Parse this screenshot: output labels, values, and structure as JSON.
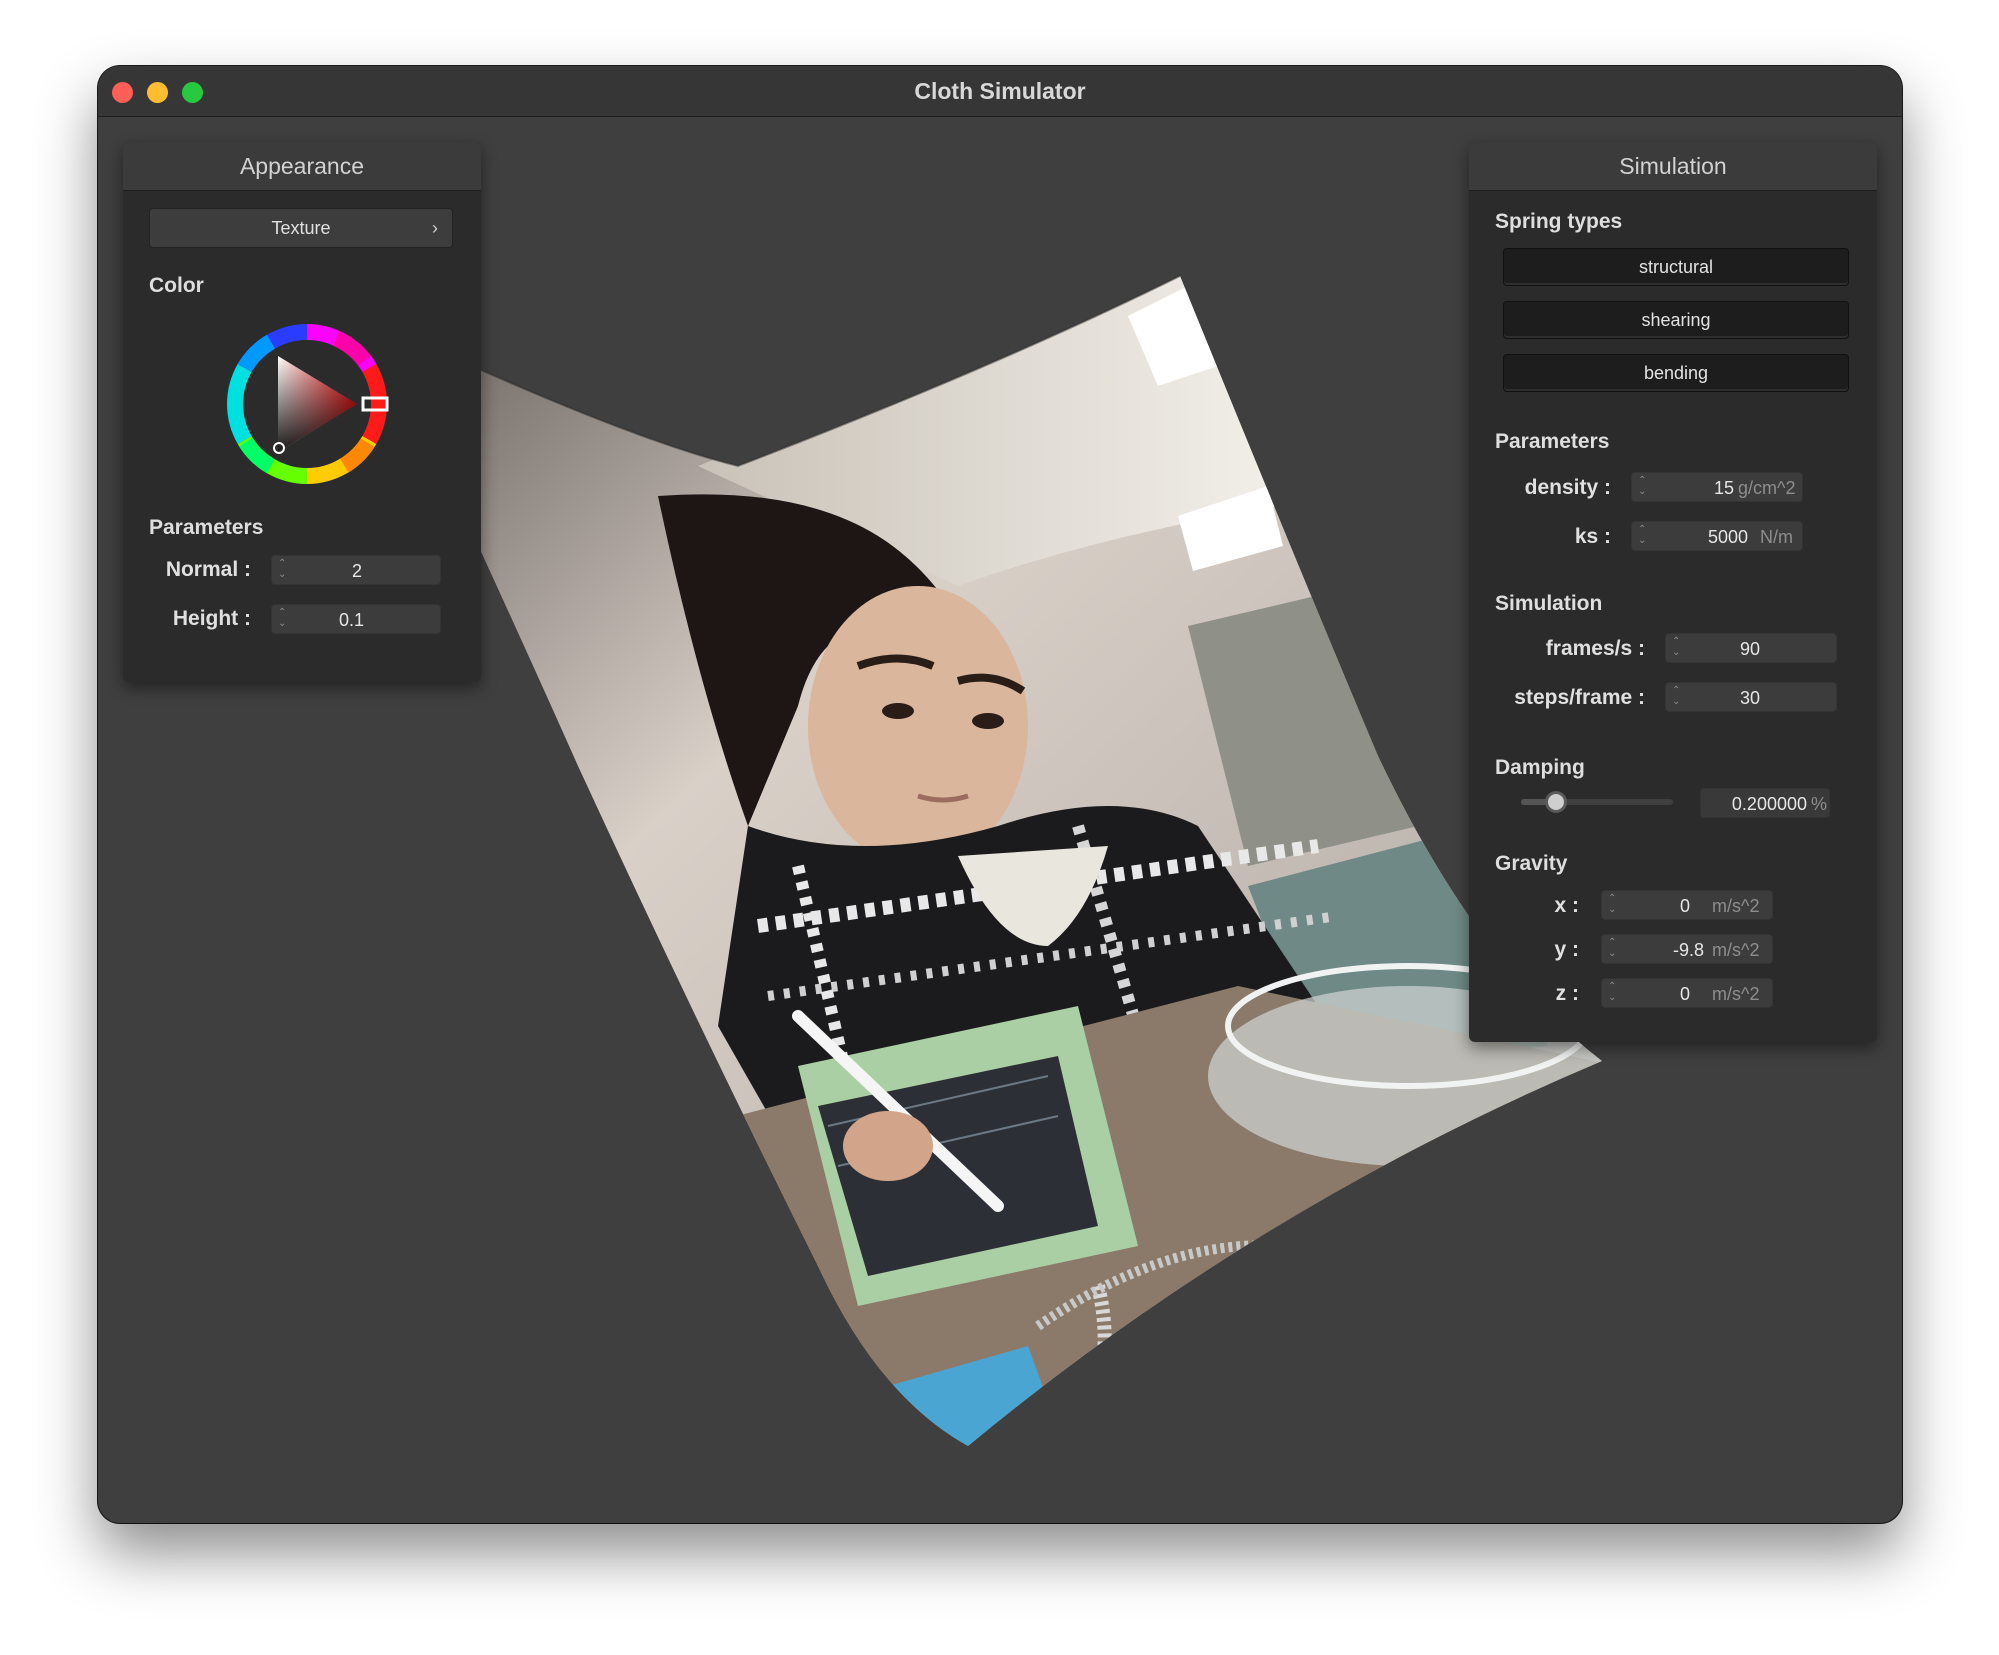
{
  "window": {
    "title": "Cloth Simulator"
  },
  "appearance": {
    "header": "Appearance",
    "texture_label": "Texture",
    "texture_chevron": "›",
    "color_label": "Color",
    "selected_color": "#e8161b",
    "parameters_label": "Parameters",
    "normal_label": "Normal :",
    "normal_value": "2",
    "height_label": "Height :",
    "height_value": "0.1"
  },
  "simulation": {
    "header": "Simulation",
    "spring_types_label": "Spring types",
    "spring_buttons": [
      "structural",
      "shearing",
      "bending"
    ],
    "parameters_label": "Parameters",
    "density_label": "density :",
    "density_value": "15",
    "density_unit": "g/cm^2",
    "ks_label": "ks :",
    "ks_value": "5000",
    "ks_unit": "N/m",
    "simulation_label": "Simulation",
    "fps_label": "frames/s :",
    "fps_value": "90",
    "steps_label": "steps/frame :",
    "steps_value": "30",
    "damping_label": "Damping",
    "damping_value": "0.200000",
    "damping_unit": "%",
    "damping_fraction": 0.2,
    "gravity_label": "Gravity",
    "gx_label": "x :",
    "gx_value": "0",
    "gy_label": "y :",
    "gy_value": "-9.8",
    "gz_label": "z :",
    "gz_value": "0",
    "gravity_unit": "m/s^2"
  },
  "icons": {
    "spinner": "up-down-stepper-icon",
    "color_wheel": "color-wheel-icon"
  },
  "colors": {
    "window_bg": "#3f3f3f",
    "panel_bg": "#2b2b2b",
    "close": "#ff5f57",
    "minimize": "#febc2e",
    "maximize": "#28c840"
  }
}
